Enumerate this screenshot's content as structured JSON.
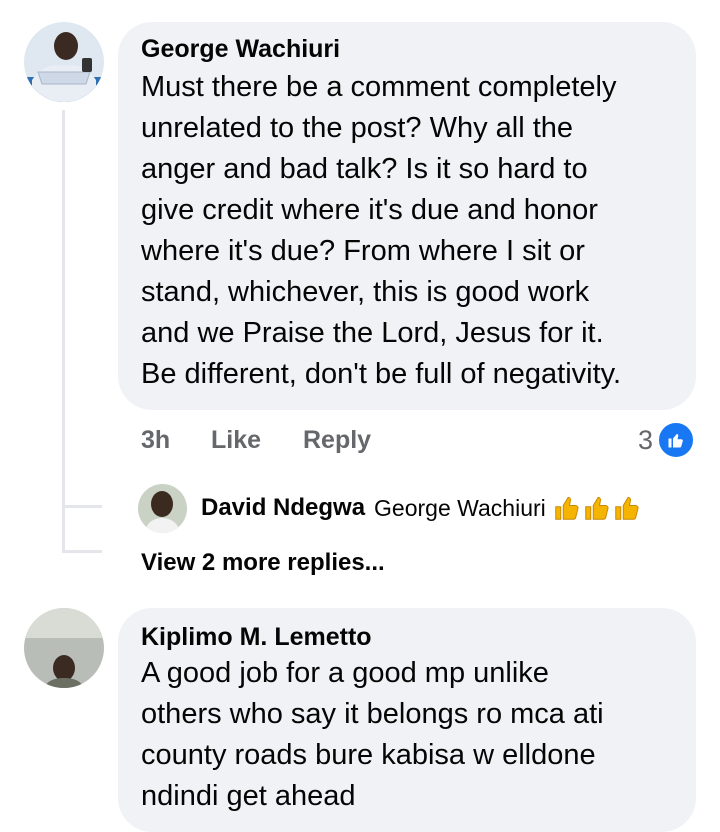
{
  "comments": [
    {
      "author": "George Wachiuri",
      "text": "Must there be a comment completely\nunrelated to the post? Why all the\nanger and bad talk? Is it so hard to\ngive credit where it's due and honor\nwhere it's due? From where I sit or\nstand, whichever, this is good work\nand we Praise the Lord, Jesus for it.\nBe different, don't be full of negativity.",
      "time": "3h",
      "like_label": "Like",
      "reply_label": "Reply",
      "reaction_count": "3",
      "reaction_icon": "like-icon"
    },
    {
      "author": "Kiplimo M. Lemetto",
      "text": "A good job for a good mp unlike\nothers who say it belongs ro mca ati\ncounty roads bure kabisa w elldone\nndindi get ahead"
    }
  ],
  "reply": {
    "author": "David Ndegwa",
    "text": "George Wachiuri",
    "emoji": [
      "thumbs-up-icon",
      "thumbs-up-icon",
      "thumbs-up-icon"
    ]
  },
  "view_more_label": "View 2 more replies...",
  "colors": {
    "bubble": "#f0f2f5",
    "meta": "#65676b",
    "like_blue": "#1877f2",
    "thread_line": "#e4e6eb"
  }
}
